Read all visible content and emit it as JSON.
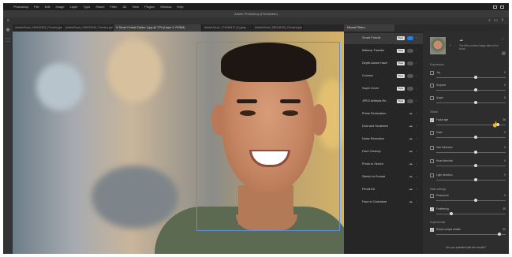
{
  "menubar": {
    "items": [
      "Photoshop",
      "File",
      "Edit",
      "Image",
      "Layer",
      "Type",
      "Select",
      "Filter",
      "3D",
      "View",
      "Plugins",
      "Window",
      "Help"
    ]
  },
  "window": {
    "title": "Adobe Photoshop (Prerelease)"
  },
  "tabs": [
    {
      "label": "AdobeStock_246931933_Preview.jpeg",
      "active": false
    },
    {
      "label": "AdobeStock_246931526_Preview.jpeg",
      "active": false
    },
    {
      "label": "G Smart Portrait Option 1.jpg @ 72% (Layer 0, RGB/8)",
      "active": true
    },
    {
      "label": "AdobeStock_174348472 (1).jpeg",
      "active": false
    },
    {
      "label": "AdobeStock_285118759_Preview.jpeg",
      "active": false
    }
  ],
  "panel": {
    "tab_label": "Neural Filters"
  },
  "filters": [
    {
      "label": "Smart Portrait",
      "badge": "Beta",
      "state": "on",
      "active": true
    },
    {
      "label": "Makeup Transfer",
      "badge": "Beta",
      "state": "off",
      "active": false
    },
    {
      "label": "Depth-Aware Haze",
      "badge": "Beta",
      "state": "off",
      "active": false
    },
    {
      "label": "Colorize",
      "badge": "Beta",
      "state": "off",
      "active": false
    },
    {
      "label": "Super Zoom",
      "badge": "Beta",
      "state": "off",
      "active": false
    },
    {
      "label": "JPEG Artifacts Re...",
      "badge": "Beta",
      "state": "off",
      "active": false
    },
    {
      "label": "Photo Restoration",
      "badge": "",
      "state": "cloud",
      "active": false
    },
    {
      "label": "Dust and Scratches",
      "badge": "",
      "state": "cloud",
      "active": false
    },
    {
      "label": "Noise Reduction",
      "badge": "",
      "state": "cloud",
      "active": false
    },
    {
      "label": "Face Cleanup",
      "badge": "",
      "state": "cloud",
      "active": false
    },
    {
      "label": "Photo to Sketch",
      "badge": "",
      "state": "cloud",
      "active": false
    },
    {
      "label": "Sketch to Portrait",
      "badge": "",
      "state": "cloud",
      "active": false
    },
    {
      "label": "Pencil Art",
      "badge": "",
      "state": "cloud",
      "active": false
    },
    {
      "label": "Face to Caricature",
      "badge": "",
      "state": "cloud",
      "active": false
    }
  ],
  "settings": {
    "message": "The filter preview image data to the cloud",
    "sections": {
      "expressions": "Expressions",
      "global": "Global",
      "mask_settings": "Mask settings",
      "experimental": "Experimental"
    },
    "rows": [
      {
        "label": "Joy",
        "value": "0",
        "checked": false,
        "level": 0.5
      },
      {
        "label": "Surprise",
        "value": "0",
        "checked": false,
        "level": 0.5
      },
      {
        "label": "Anger",
        "value": "0",
        "checked": false,
        "level": 0.5
      },
      {
        "label": "Facial age",
        "value": "36",
        "checked": true,
        "level": 0.62
      },
      {
        "label": "Gaze",
        "value": "0",
        "checked": false,
        "level": 0.5
      },
      {
        "label": "Hair thickness",
        "value": "0",
        "checked": false,
        "level": 0.5
      },
      {
        "label": "Head direction",
        "value": "0",
        "checked": false,
        "level": 0.5
      },
      {
        "label": "Light direction",
        "value": "0",
        "checked": false,
        "level": 0.5
      },
      {
        "label": "Placement",
        "value": "0",
        "checked": false,
        "level": 0.5
      },
      {
        "label": "Feathering",
        "value": "20",
        "checked": true,
        "level": 0.2
      },
      {
        "label": "Retain unique details",
        "value": "90",
        "checked": true,
        "level": 0.9
      }
    ],
    "feedback": "Are you satisfied with the results?"
  }
}
